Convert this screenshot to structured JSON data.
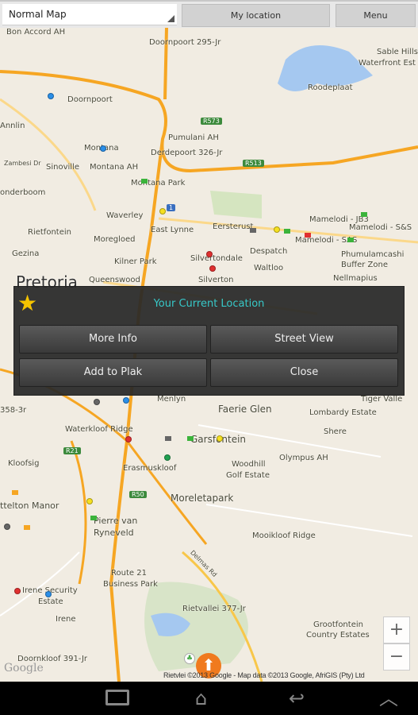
{
  "topbar": {
    "map_type": "Normal Map",
    "my_location": "My location",
    "menu": "Menu"
  },
  "map": {
    "labels": [
      "Bon Accord AH",
      "Doornpoort 295-Jr",
      "Sable Hills",
      "Waterfront Est",
      "Roodeplaat",
      "Doornpoort",
      "Annlin",
      "Pumulani AH",
      "Montana",
      "Derdepoort 326-Jr",
      "Zambesi Dr",
      "Sinoville",
      "Montana AH",
      "Montana Park",
      "onderboom",
      "Waverley",
      "Eersterust",
      "Mamelodi - JB3",
      "Rietfontein",
      "Moregloed",
      "East Lynne",
      "Mamelodi - S&S",
      "Despatch",
      "Mamelodi - SAS",
      "Phumulamcashi",
      "Buffer Zone",
      "Gezina",
      "Kilner Park",
      "Silvertondale",
      "Waltloo",
      "Silverton",
      "Queenswood",
      "Pretoria",
      "Nellmapius",
      "Menlyn",
      "Faerie Glen",
      "Tiger Valle",
      "Lombardy Estate",
      "Shere",
      "358-3r",
      "Waterkloof Ridge",
      "Garsfontein",
      "Erasmuskloof",
      "Kloofsig",
      "Woodhill",
      "Golf Estate",
      "Olympus AH",
      "Moreletapark",
      "ttelton Manor",
      "Pierre van",
      "Ryneveld",
      "Mooikloof Ridge",
      "Route 21",
      "Business Park",
      "Irene Security",
      "Estate",
      "Rietvallei 377-Jr",
      "Irene",
      "Grootfontein",
      "Country Estates",
      "Doornkloof 391-Jr",
      "Delmas Rd"
    ],
    "shields": [
      "R573",
      "R513",
      "1",
      "R21",
      "R50"
    ],
    "copyright": "Rietvlei ©2013 Google - Map data ©2013 Google, AfriGIS (Pty) Ltd",
    "google_logo": "Google",
    "zoom_in": "+",
    "zoom_out": "−"
  },
  "dialog": {
    "title": "Your Current Location",
    "icon": "star-icon",
    "buttons": [
      "More Info",
      "Street View",
      "Add to Plak",
      "Close"
    ]
  },
  "colors": {
    "accent": "#37c9c9",
    "road": "#f6a623",
    "home": "#f07a1e"
  },
  "navbar": {
    "icons": [
      "recent-apps-icon",
      "home-icon",
      "back-icon",
      "up-icon"
    ]
  }
}
